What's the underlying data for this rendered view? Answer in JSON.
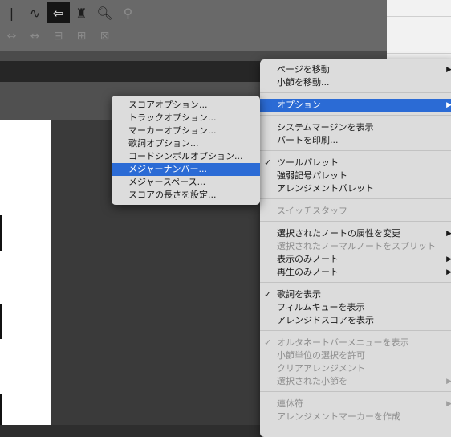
{
  "toolbar": {
    "row1": [
      {
        "icon": "bracket-tool-icon",
        "glyph": "|",
        "active": false
      },
      {
        "icon": "curve-tool-icon",
        "glyph": "∿",
        "active": false
      },
      {
        "icon": "arrow-left-tool-icon",
        "glyph": "⇦",
        "active": true
      },
      {
        "icon": "eraser-tool-icon",
        "glyph": "♜",
        "active": false
      },
      {
        "icon": "zoom-tool-icon",
        "glyph": "🔍︎",
        "active": false
      },
      {
        "icon": "playback-cursor-tool-icon",
        "glyph": "⚲",
        "active": false
      }
    ],
    "row2": [
      {
        "icon": "expand-horizontal-icon",
        "glyph": "⇔"
      },
      {
        "icon": "spacing-tool-icon",
        "glyph": "⇹"
      },
      {
        "icon": "measure-width-icon",
        "glyph": "⊟"
      },
      {
        "icon": "staff-resize-icon",
        "glyph": "⊞"
      },
      {
        "icon": "system-resize-icon",
        "glyph": "⊠"
      }
    ]
  },
  "main_menu": {
    "items": [
      {
        "label": "ページを移動",
        "submenu": true,
        "disabled": false,
        "checked": false,
        "selected": false
      },
      {
        "label": "小節を移動...",
        "submenu": false,
        "disabled": false,
        "checked": false,
        "selected": false
      },
      {
        "label": "オプション",
        "submenu": true,
        "disabled": false,
        "checked": false,
        "selected": true
      },
      {
        "label": "システムマージンを表示",
        "submenu": false,
        "disabled": false,
        "checked": false,
        "selected": false
      },
      {
        "label": "パートを印刷...",
        "submenu": false,
        "disabled": false,
        "checked": false,
        "selected": false
      },
      {
        "label": "ツールパレット",
        "submenu": false,
        "disabled": false,
        "checked": true,
        "selected": false
      },
      {
        "label": "強弱記号パレット",
        "submenu": false,
        "disabled": false,
        "checked": false,
        "selected": false
      },
      {
        "label": "アレンジメントパレット",
        "submenu": false,
        "disabled": false,
        "checked": false,
        "selected": false
      },
      {
        "label": "スイッチスタッフ",
        "submenu": false,
        "disabled": true,
        "checked": false,
        "selected": false
      },
      {
        "label": "選択されたノートの属性を変更",
        "submenu": true,
        "disabled": false,
        "checked": false,
        "selected": false
      },
      {
        "label": "選択されたノーマルノートをスプリット",
        "submenu": false,
        "disabled": true,
        "checked": false,
        "selected": false
      },
      {
        "label": "表示のみノート",
        "submenu": true,
        "disabled": false,
        "checked": false,
        "selected": false
      },
      {
        "label": "再生のみノート",
        "submenu": true,
        "disabled": false,
        "checked": false,
        "selected": false
      },
      {
        "label": "歌詞を表示",
        "submenu": false,
        "disabled": false,
        "checked": true,
        "selected": false
      },
      {
        "label": "フィルムキューを表示",
        "submenu": false,
        "disabled": false,
        "checked": false,
        "selected": false
      },
      {
        "label": "アレンジドスコアを表示",
        "submenu": false,
        "disabled": false,
        "checked": false,
        "selected": false
      },
      {
        "label": "オルタネートバーメニューを表示",
        "submenu": false,
        "disabled": true,
        "checked": true,
        "selected": false
      },
      {
        "label": "小節単位の選択を許可",
        "submenu": false,
        "disabled": true,
        "checked": false,
        "selected": false
      },
      {
        "label": "クリアアレンジメント",
        "submenu": false,
        "disabled": true,
        "checked": false,
        "selected": false
      },
      {
        "label": "選択された小節を",
        "submenu": true,
        "disabled": true,
        "checked": false,
        "selected": false
      },
      {
        "label": "連休符",
        "submenu": true,
        "disabled": true,
        "checked": false,
        "selected": false
      },
      {
        "label": "アレンジメントマーカーを作成",
        "submenu": false,
        "disabled": true,
        "checked": false,
        "selected": false
      }
    ]
  },
  "sub_menu": {
    "items": [
      {
        "label": "スコアオプション...",
        "selected": false
      },
      {
        "label": "トラックオプション...",
        "selected": false
      },
      {
        "label": "マーカーオプション...",
        "selected": false
      },
      {
        "label": "歌詞オプション...",
        "selected": false
      },
      {
        "label": "コードシンボルオプション...",
        "selected": false
      },
      {
        "label": "メジャーナンバー...",
        "selected": true
      },
      {
        "label": "メジャースペース...",
        "selected": false
      },
      {
        "label": "スコアの長さを設定...",
        "selected": false
      }
    ]
  },
  "colors": {
    "menu_bg": "#dcdcdc",
    "selection": "#2b6bd5",
    "disabled_text": "#8e8e8e",
    "toolbar": "#696969"
  }
}
